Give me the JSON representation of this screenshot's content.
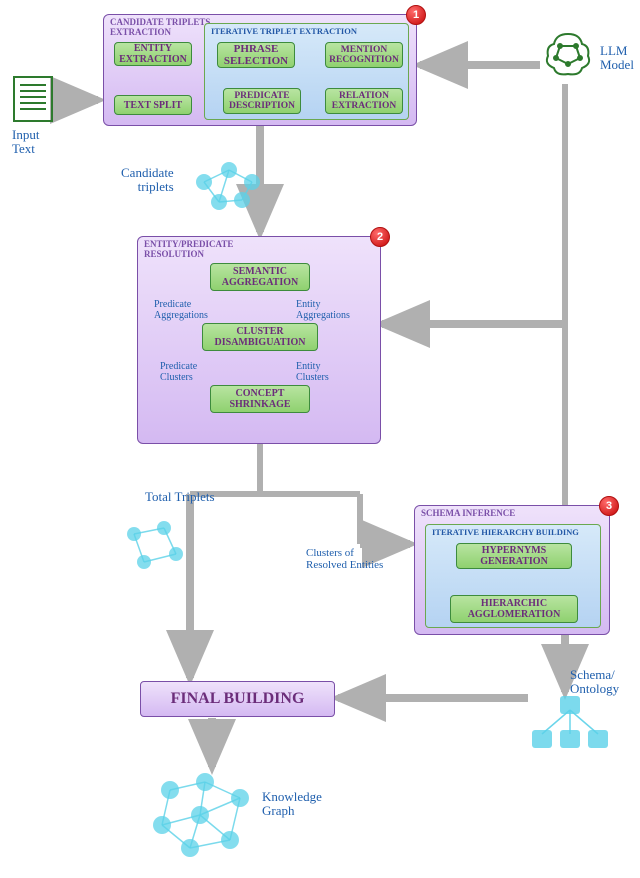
{
  "input": {
    "label": "Input\nText"
  },
  "llm": {
    "label": "LLM\nModel"
  },
  "panel1": {
    "title": "CANDIDATE TRIPLETS\nEXTRACTION",
    "entity_extraction": "ENTITY\nEXTRACTION",
    "text_split": "TEXT SPLIT",
    "inner_title": "ITERATIVE TRIPLET EXTRACTION",
    "phrase_selection": "PHRASE\nSELECTION",
    "mention_recognition": "MENTION\nRECOGNITION",
    "predicate_description": "PREDICATE\nDESCRIPTION",
    "relation_extraction": "RELATION\nEXTRACTION",
    "badge": "1"
  },
  "candidate_triplets_label": "Candidate\ntriplets",
  "panel2": {
    "title": "ENTITY/PREDICATE\nRESOLUTION",
    "semantic_aggregation": "SEMANTIC\nAGGREGATION",
    "cluster_disambiguation": "CLUSTER\nDISAMBIGUATION",
    "concept_shrinkage": "CONCEPT\nSHRINKAGE",
    "badge": "2",
    "predicate_aggregations": "Predicate\nAggregations",
    "entity_aggregations": "Entity\nAggregations",
    "predicate_clusters": "Predicate\nClusters",
    "entity_clusters": "Entity\nClusters"
  },
  "total_triplets_label": "Total Triplets",
  "clusters_resolved_label": "Clusters of\nResolved Entities",
  "panel3": {
    "title": "SCHEMA INFERENCE",
    "inner_title": "ITERATIVE HIERARCHY BUILDING",
    "hypernyms_generation": "HYPERNYMS\nGENERATION",
    "hierarchic_agglomeration": "HIERARCHIC\nAGGLOMERATION",
    "badge": "3"
  },
  "schema_label": "Schema/\nOntology",
  "final_building": "FINAL BUILDING",
  "knowledge_graph_label": "Knowledge\nGraph"
}
